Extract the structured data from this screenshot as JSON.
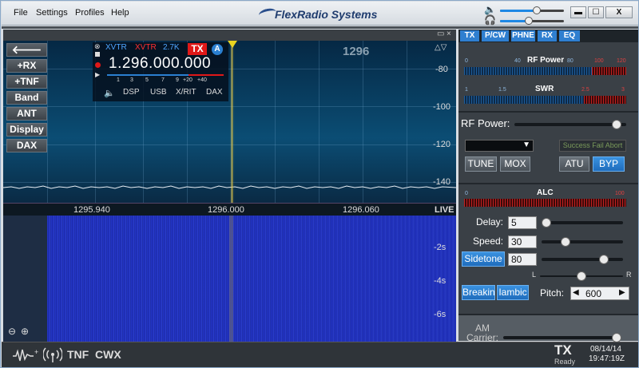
{
  "menu": {
    "file": "File",
    "settings": "Settings",
    "profiles": "Profiles",
    "help": "Help"
  },
  "brand": {
    "name": "FlexRadio Systems"
  },
  "window": {
    "minimize": "▬",
    "maximize": "☐",
    "close": "X"
  },
  "pan_header": {
    "minimize": "▭",
    "close": "×"
  },
  "tabs": [
    "TX",
    "P/CW",
    "PHNE",
    "RX",
    "EQ"
  ],
  "left_buttons": [
    "+RX",
    "+TNF",
    "Band",
    "ANT",
    "Display",
    "DAX"
  ],
  "pan": {
    "band_label": "1296",
    "db_labels": [
      "-80",
      "-100",
      "-120",
      "-140"
    ],
    "freq_ticks": [
      "1295.940",
      "1296.000",
      "1296.060"
    ],
    "live": "LIVE",
    "time_labels": [
      "-2s",
      "-4s",
      "-6s"
    ]
  },
  "vfo": {
    "xvtr_a": "XVTR",
    "xvtr_b": "XVTR",
    "bandwidth": "2.7K",
    "tx_badge": "TX",
    "slice_letter": "A",
    "frequency": "1.296.000.000",
    "meter_scale": [
      "1",
      "3",
      "5",
      "7",
      "9",
      "+20",
      "+40"
    ],
    "buttons": [
      "DSP",
      "USB",
      "X/RIT",
      "DAX"
    ]
  },
  "rf_power_meter": {
    "title": "RF Power",
    "scale": [
      "0",
      "40",
      "80",
      "100",
      "120"
    ]
  },
  "swr_meter": {
    "title": "SWR",
    "scale": [
      "1",
      "1.5",
      "2.5",
      "3"
    ]
  },
  "tx_controls": {
    "rf_power_label": "RF Power:",
    "rf_power_level": 0.95,
    "atu_status": [
      "Success",
      "Fail",
      "Abort"
    ],
    "tune": "TUNE",
    "mox": "MOX",
    "atu": "ATU",
    "byp": "BYP"
  },
  "alc_meter": {
    "title": "ALC",
    "scale": [
      "0",
      "100"
    ]
  },
  "cw": {
    "delay_label": "Delay:",
    "delay": "5",
    "delay_level": 0.0,
    "speed_label": "Speed:",
    "speed": "30",
    "speed_level": 0.27,
    "sidetone": "Sidetone",
    "sidetone_value": "80",
    "sidetone_level": 0.8,
    "pan_left": "L",
    "pan_right": "R",
    "breakin": "Breakin",
    "iambic": "Iambic",
    "pitch_label": "Pitch:",
    "pitch": "600"
  },
  "am_carrier": {
    "label": "AM Carrier:"
  },
  "status_bar": {
    "tnf": "TNF",
    "cwx": "CWX",
    "tx": "TX",
    "tx_state": "Ready",
    "date": "08/14/14",
    "time": "19:47:19Z"
  }
}
